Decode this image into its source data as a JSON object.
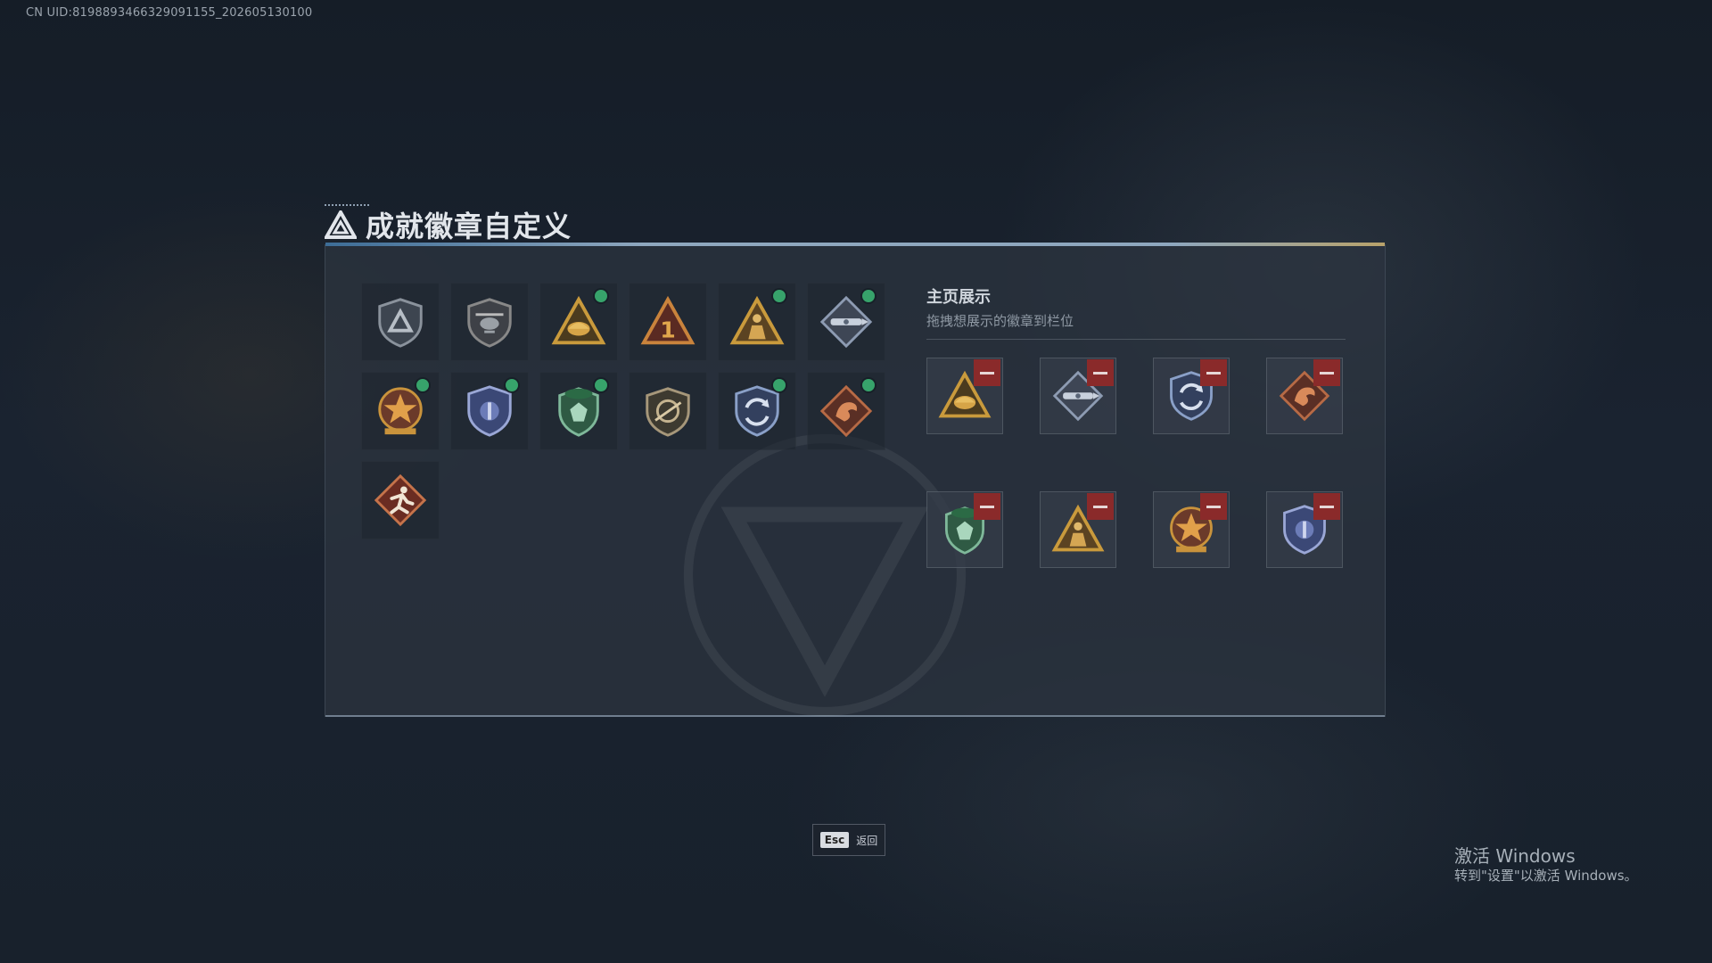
{
  "uid_text": "CN UID:8198893466329091155_202605130100",
  "header": {
    "title": "成就徽章自定义",
    "icon": "delta-triangle-icon"
  },
  "badges": [
    {
      "name": "shield-delta-badge",
      "new": false
    },
    {
      "name": "helicopter-badge",
      "new": false
    },
    {
      "name": "gold-triangle-badge",
      "new": true
    },
    {
      "name": "rank-one-badge",
      "new": false
    },
    {
      "name": "soldier-triangle-badge",
      "new": true
    },
    {
      "name": "rocket-diamond-badge",
      "new": true
    },
    {
      "name": "star-wreath-badge",
      "new": true
    },
    {
      "name": "blue-shield-badge",
      "new": true
    },
    {
      "name": "green-crest-badge",
      "new": true
    },
    {
      "name": "rifle-shield-badge",
      "new": false
    },
    {
      "name": "arrows-shield-badge",
      "new": true
    },
    {
      "name": "dragon-diamond-badge",
      "new": true
    },
    {
      "name": "runner-diamond-badge",
      "new": false
    }
  ],
  "showcase": {
    "title": "主页展示",
    "subtitle": "拖拽想展示的徽章到栏位",
    "slots": [
      "gold-triangle-badge",
      "rocket-diamond-badge",
      "arrows-shield-badge",
      "dragon-diamond-badge",
      "green-crest-badge",
      "soldier-triangle-badge",
      "star-wreath-badge",
      "blue-shield-badge"
    ]
  },
  "footer": {
    "esc_key": "Esc",
    "back_label": "返回"
  },
  "windows_watermark": {
    "line1": "激活 Windows",
    "line2": "转到\"设置\"以激活 Windows。"
  },
  "colors": {
    "new_dot": "#37a36b",
    "remove_button": "#8a2a2a",
    "accent_bar": "#8ea7be"
  }
}
